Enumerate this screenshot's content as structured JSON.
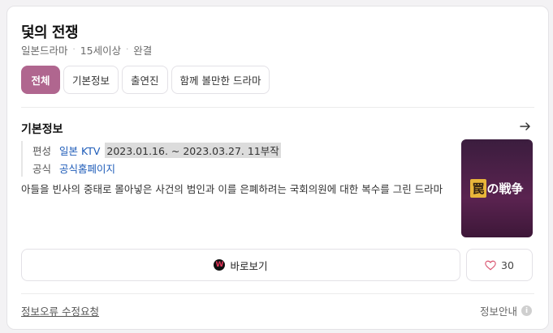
{
  "header": {
    "title": "덫의 전쟁",
    "meta": [
      "일본드라마",
      "15세이상",
      "완결"
    ],
    "meta_separator": "·"
  },
  "tabs": [
    {
      "label": "전체",
      "active": true
    },
    {
      "label": "기본정보",
      "active": false
    },
    {
      "label": "출연진",
      "active": false
    },
    {
      "label": "함께 볼만한 드라마",
      "active": false
    }
  ],
  "basic_info": {
    "section_title": "기본정보",
    "rows": [
      {
        "label": "편성",
        "value": "일본 KTV",
        "extra": "2023.01.16. ~ 2023.03.27. 11부작"
      },
      {
        "label": "공식",
        "value": "공식홈페이지"
      }
    ],
    "description": "아들을 빈사의 중태로 몰아넣은 사건의 범인과 이를 은폐하려는 국회의원에 대한 복수를 그린 드라마",
    "poster_text": {
      "box": "罠",
      "rest": "の戦争"
    }
  },
  "actions": {
    "watch_label": "바로보기",
    "watch_icon_letter": "W",
    "like_count": "30"
  },
  "footer": {
    "report_label": "정보오류 수정요청",
    "guide_label": "정보안내",
    "guide_icon": "i"
  },
  "colors": {
    "accent": "#b0668f",
    "link": "#1d5bb8"
  }
}
